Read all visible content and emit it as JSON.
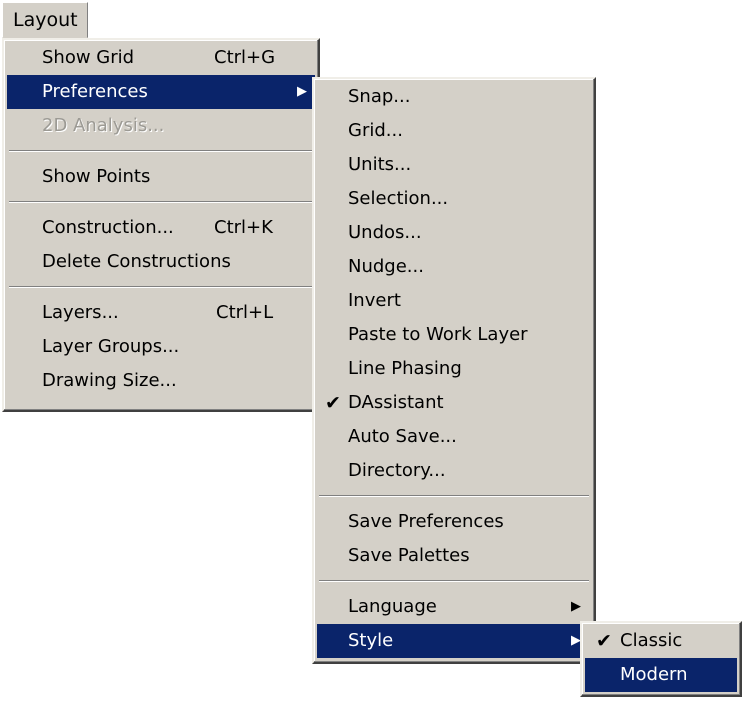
{
  "menubar": {
    "layout_label": "Layout"
  },
  "layout_menu": {
    "show_grid": {
      "label": "Show Grid",
      "shortcut": "Ctrl+G"
    },
    "preferences": {
      "label": "Preferences"
    },
    "analysis_2d": {
      "label": "2D Analysis..."
    },
    "show_points": {
      "label": "Show Points"
    },
    "construction": {
      "label": "Construction...",
      "shortcut": "Ctrl+K"
    },
    "delete_constructions": {
      "label": "Delete Constructions"
    },
    "layers": {
      "label": "Layers...",
      "shortcut": "Ctrl+L"
    },
    "layer_groups": {
      "label": "Layer Groups..."
    },
    "drawing_size": {
      "label": "Drawing Size..."
    }
  },
  "preferences_menu": {
    "snap": "Snap...",
    "grid": "Grid...",
    "units": "Units...",
    "selection": "Selection...",
    "undos": "Undos...",
    "nudge": "Nudge...",
    "invert": "Invert",
    "paste_to_work_layer": "Paste to Work Layer",
    "line_phasing": "Line Phasing",
    "dassistant": {
      "label": "DAssistant",
      "checked": true
    },
    "auto_save": "Auto Save...",
    "directory": "Directory...",
    "save_preferences": "Save Preferences",
    "save_palettes": "Save Palettes",
    "language": "Language",
    "style": "Style"
  },
  "style_menu": {
    "classic": {
      "label": "Classic",
      "checked": true
    },
    "modern": {
      "label": "Modern"
    }
  },
  "colors": {
    "menu_bg": "#d4d0c8",
    "highlight": "#0a246a",
    "highlight_text": "#ffffff",
    "disabled_text": "#9c9a94"
  },
  "icons": {
    "submenu_arrow": "triangle-right-icon",
    "checkmark": "checkmark-icon"
  }
}
